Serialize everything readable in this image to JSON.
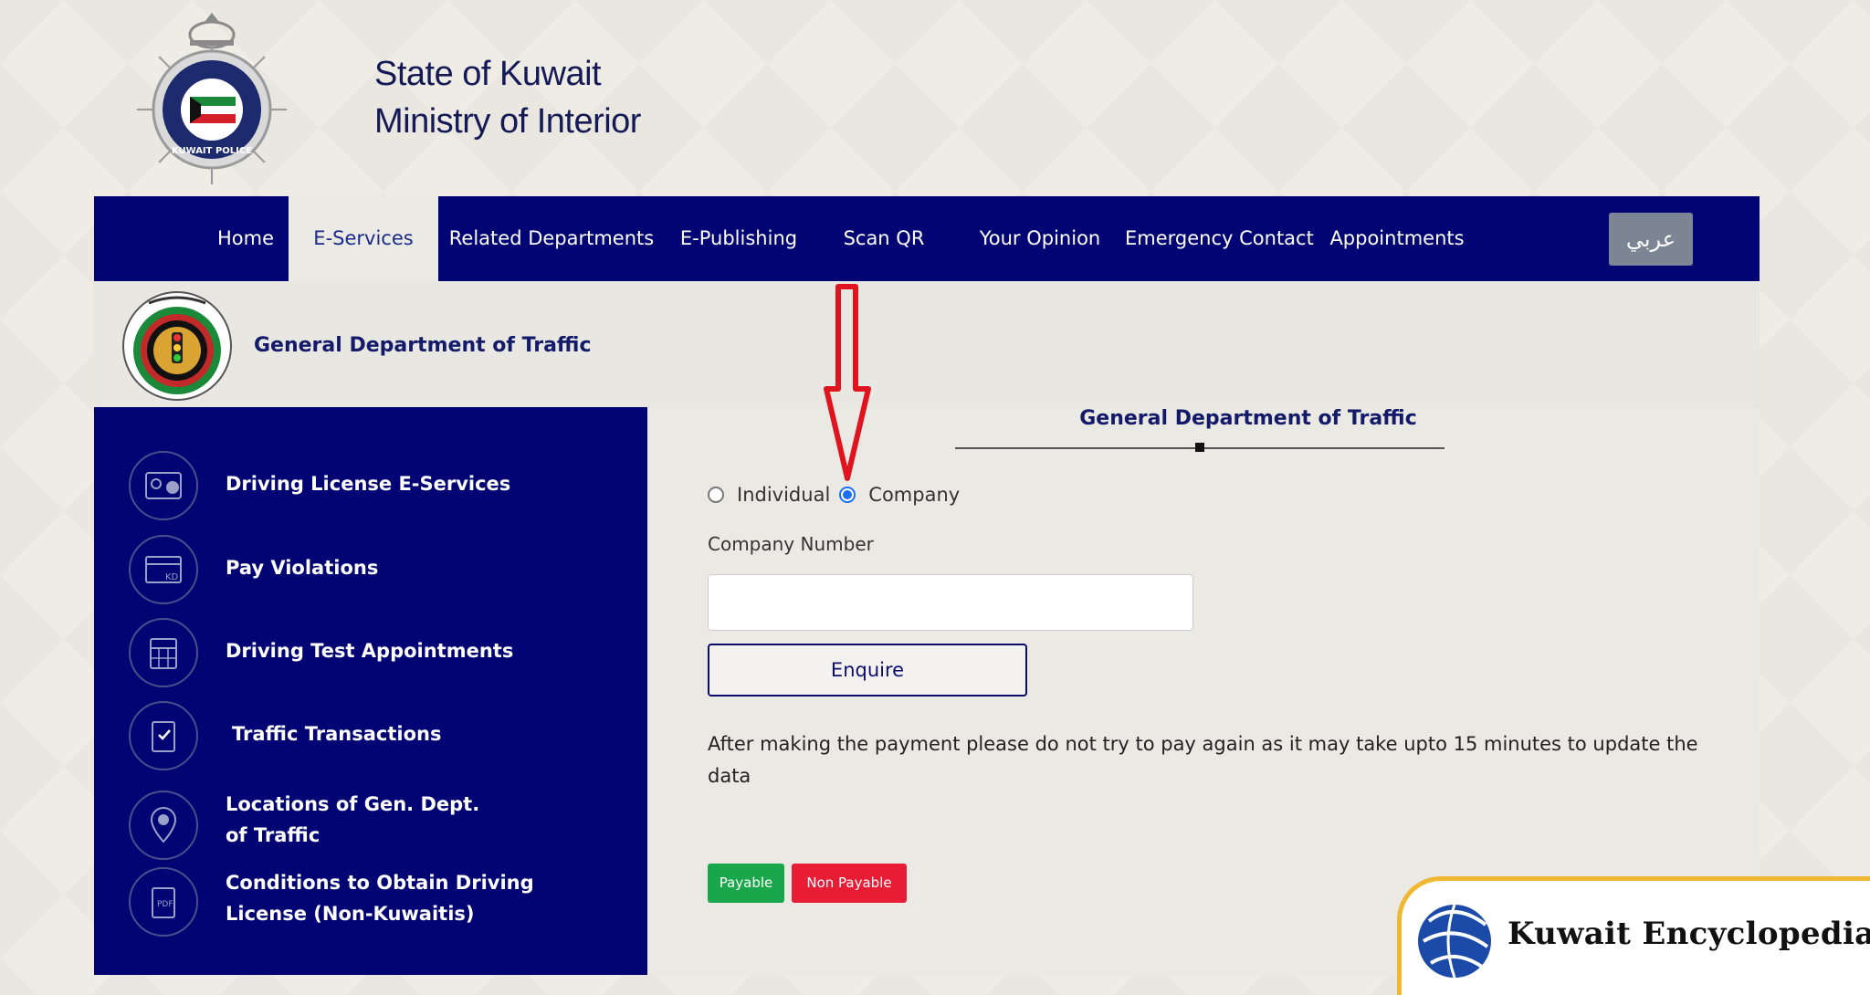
{
  "header": {
    "title_line1": "State of Kuwait",
    "title_line2": "Ministry of Interior",
    "logo_text": "KUWAIT POLICE"
  },
  "nav": {
    "items": [
      {
        "label": "Home",
        "active": false
      },
      {
        "label": "E-Services",
        "active": true
      },
      {
        "label": "Related Departments",
        "active": false
      },
      {
        "label": "E-Publishing",
        "active": false
      },
      {
        "label": "Scan QR",
        "active": false
      },
      {
        "label": "Your Opinion",
        "active": false
      },
      {
        "label": "Emergency Contact",
        "active": false
      },
      {
        "label": "Appointments",
        "active": false
      }
    ],
    "language_button": "عربي"
  },
  "department": {
    "title": "General Department of Traffic"
  },
  "sidebar": {
    "items": [
      {
        "label": "Driving License E-Services",
        "icon": "license-card-icon"
      },
      {
        "label": "Pay Violations",
        "icon": "kd-card-icon"
      },
      {
        "label": "Driving Test Appointments",
        "icon": "calendar-icon"
      },
      {
        "label": "Traffic Transactions",
        "icon": "document-check-icon"
      },
      {
        "label": "Locations of Gen. Dept. of Traffic",
        "icon": "location-pin-icon"
      },
      {
        "label": "Conditions to Obtain Driving License (Non-Kuwaitis)",
        "icon": "pdf-document-icon"
      }
    ]
  },
  "main": {
    "section_title": "General Department of Traffic",
    "radio_individual": "Individual",
    "radio_company": "Company",
    "selected": "Company",
    "field_label": "Company Number",
    "field_value": "",
    "enquire_button": "Enquire",
    "note": "After making the payment please do not try to pay again as it may take upto 15 minutes to update the data",
    "badge_payable": "Payable",
    "badge_non_payable": "Non Payable"
  },
  "watermark": {
    "text": "Kuwait Encyclopedia"
  },
  "colors": {
    "nav_bg": "#020473",
    "accent_blue": "#1f6ff5",
    "payable": "#1aa64b",
    "non_payable": "#e81c34",
    "arrow": "#e0141e",
    "watermark_border": "#f0b830"
  }
}
